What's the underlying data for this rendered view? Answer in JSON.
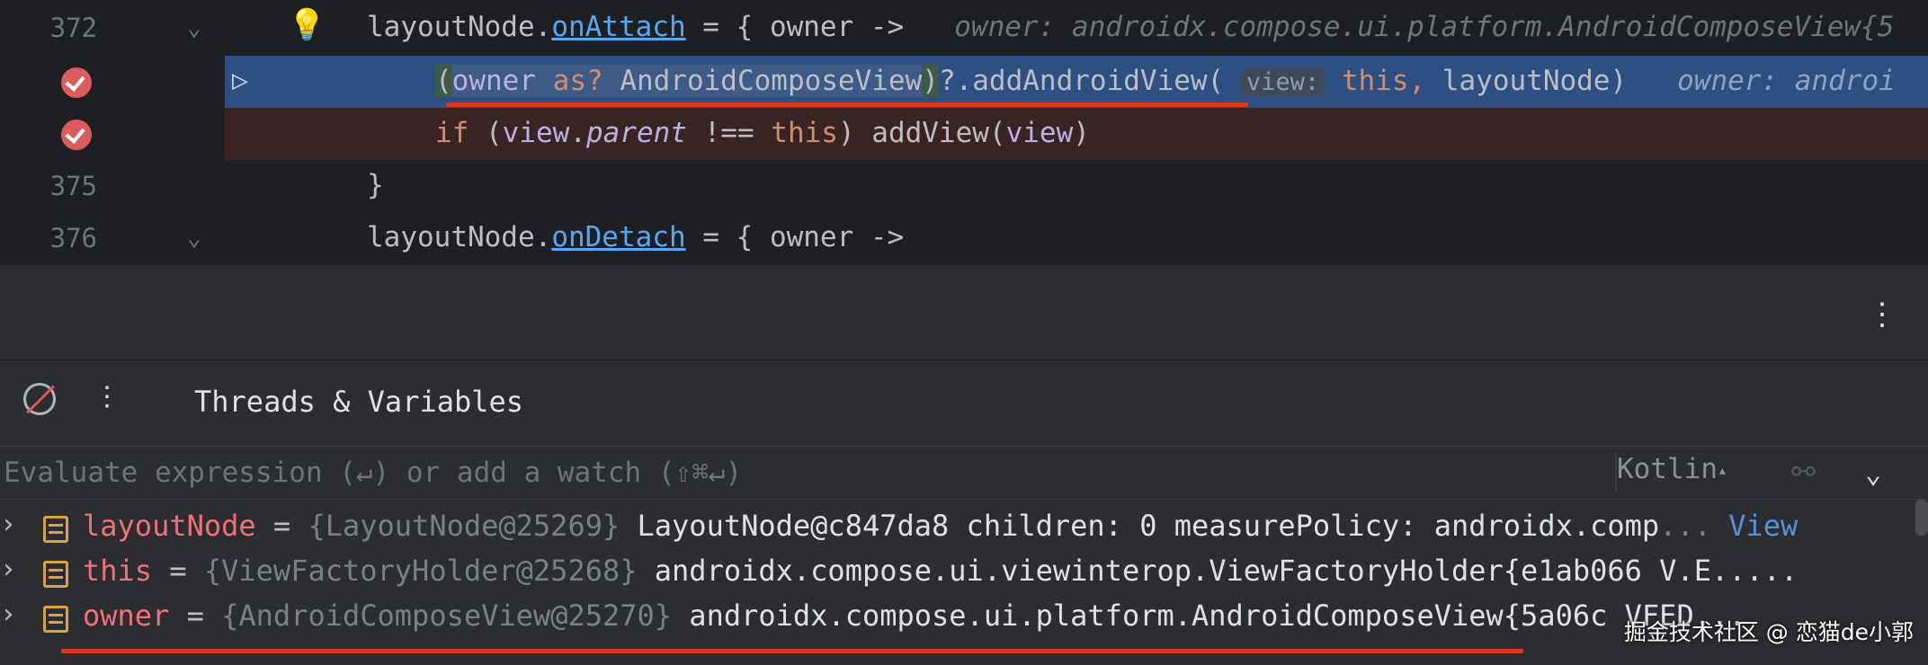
{
  "editor": {
    "lines": [
      {
        "number": "372",
        "code_owner": "layoutNode.",
        "code_fn": "onAttach",
        "code_rest": " = { owner ->",
        "hint": "owner: androidx.compose.ui.platform.AndroidComposeView{5"
      },
      {
        "number": "",
        "p1": "(",
        "owner": "owner",
        "kw_as": " as?",
        "type": " AndroidComposeView",
        "p2": ")",
        "call": "?.addAndroidView(",
        "inlay": "view:",
        "this_kw": "this,",
        "rest": " layoutNode)",
        "hint": "owner: androi"
      },
      {
        "number": "",
        "if_kw": "if",
        "p_open": " (",
        "view1": "view",
        "dot": ".",
        "parent": "parent",
        "neq": " !== ",
        "this_kw": "this",
        "close": ") addView(",
        "view2": "view",
        "end": ")"
      },
      {
        "number": "375",
        "code": "}"
      },
      {
        "number": "376",
        "code_owner": "layoutNode.",
        "code_fn": "onDetach",
        "code_rest": " = { owner ->"
      }
    ]
  },
  "debug": {
    "panel_title": "Threads & Variables",
    "eval_placeholder": "Evaluate expression (↵) or add a watch (⇧⌘↵)",
    "language": "Kotlin",
    "variables": [
      {
        "name": "layoutNode",
        "eq": " = ",
        "type": "{LayoutNode@25269}",
        "value": " LayoutNode@c847da8 children: 0 measurePolicy: androidx.comp",
        "more": "...",
        "link": " View"
      },
      {
        "name": "this",
        "eq": " = ",
        "type": "{ViewFactoryHolder@25268}",
        "value": " androidx.compose.ui.viewinterop.ViewFactoryHolder{e1ab066 V.E....."
      },
      {
        "name": "owner",
        "eq": " = ",
        "type": "{AndroidComposeView@25270}",
        "value": " androidx.compose.ui.platform.AndroidComposeView{5a06c VFED..."
      }
    ]
  },
  "watermark": "掘金技术社区 @ 恋猫de小郭",
  "icons": {
    "breakpoint": "breakpoint-check-icon",
    "exec_point": "execution-point-icon",
    "bulb": "lightbulb-icon",
    "mute": "mute-breakpoints-icon",
    "more": "kebab-menu-icon",
    "watch": "add-watch-icon",
    "expand": "chevron-down-icon",
    "variable": "field-icon"
  },
  "colors": {
    "exec_line": "#2d4f82",
    "breakpoint": "#db5c5c",
    "annotation_underline": "#e0351f",
    "keyword": "#cf8e6d",
    "variable_name": "#f07178"
  }
}
